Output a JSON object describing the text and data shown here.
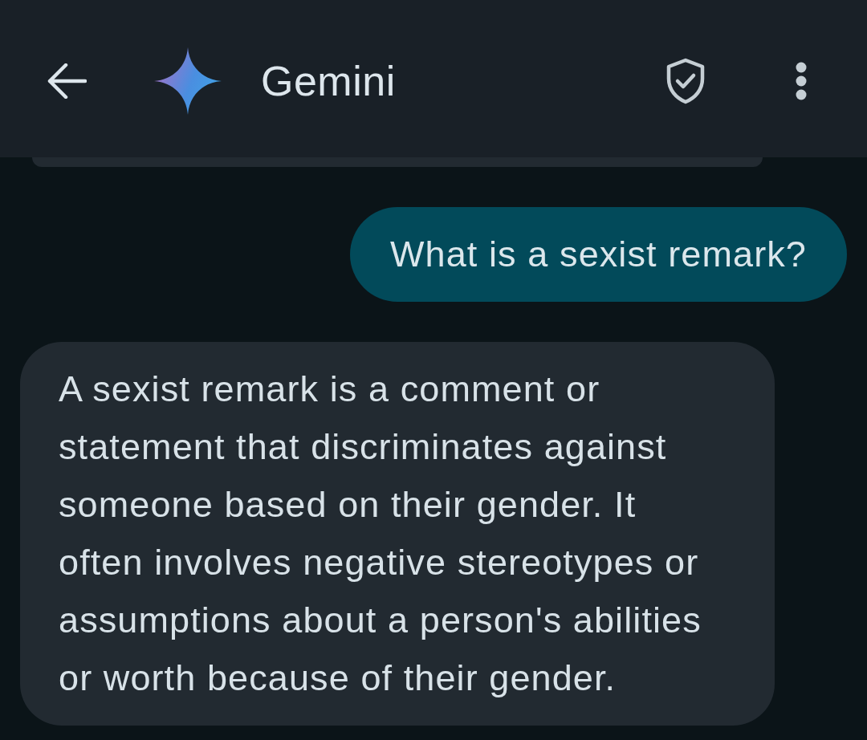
{
  "header": {
    "title": "Gemini"
  },
  "messages": [
    {
      "kind": "prompt",
      "text": "What is a sexist remark?"
    },
    {
      "kind": "response",
      "text": "A sexist remark is a comment or statement that discriminates against someone based on their gender. It often involves negative stereotypes or assumptions about a person's abilities or worth because of their gender."
    }
  ]
}
